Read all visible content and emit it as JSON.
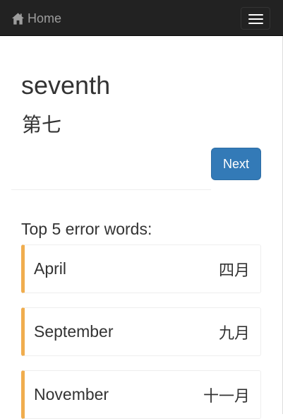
{
  "navbar": {
    "brand_icon": "home-icon",
    "brand_label": "Home",
    "menu_icon": "hamburger-menu-icon"
  },
  "card": {
    "word": "seventh",
    "translation": "第七"
  },
  "next_button_label": "Next",
  "errors": {
    "title": "Top 5 error words:",
    "items": [
      {
        "english": "April",
        "chinese": "四月"
      },
      {
        "english": "September",
        "chinese": "九月"
      },
      {
        "english": "November",
        "chinese": "十一月"
      }
    ]
  },
  "colors": {
    "navbar_bg": "#222222",
    "primary": "#337ab7",
    "warning_accent": "#f0ad4e"
  }
}
